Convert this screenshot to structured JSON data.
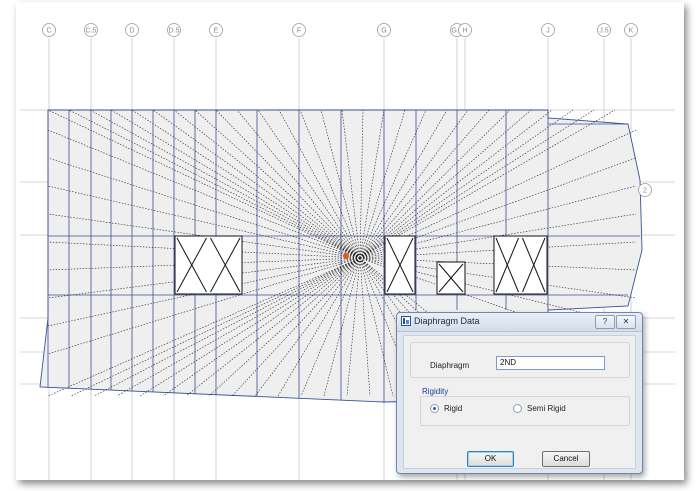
{
  "grid_bubbles_top": [
    "C",
    "C.5",
    "D",
    "D.5",
    "E",
    "F",
    "G",
    "G.9",
    "H",
    "J",
    "J.5",
    "K"
  ],
  "grid_bubble_right": "2",
  "dialog": {
    "title": "Diaphragm Data",
    "help_label": "?",
    "close_label": "✕",
    "diaphragm_label": "Diaphragm",
    "diaphragm_value": "2ND",
    "rigidity_label": "Rigidity",
    "rigid_option": "Rigid",
    "semi_rigid_option": "Semi Rigid",
    "selected_option": "Rigid",
    "ok_label": "OK",
    "cancel_label": "Cancel",
    "title_icon": "app-icon"
  },
  "colors": {
    "slab_fill": "#efefef",
    "beam_line": "#3b4f9a",
    "grid_line": "#c8c8c8",
    "load_line": "#222222",
    "dialog_accent": "#1a3b9a",
    "origin_marker": "#e05a1a"
  }
}
